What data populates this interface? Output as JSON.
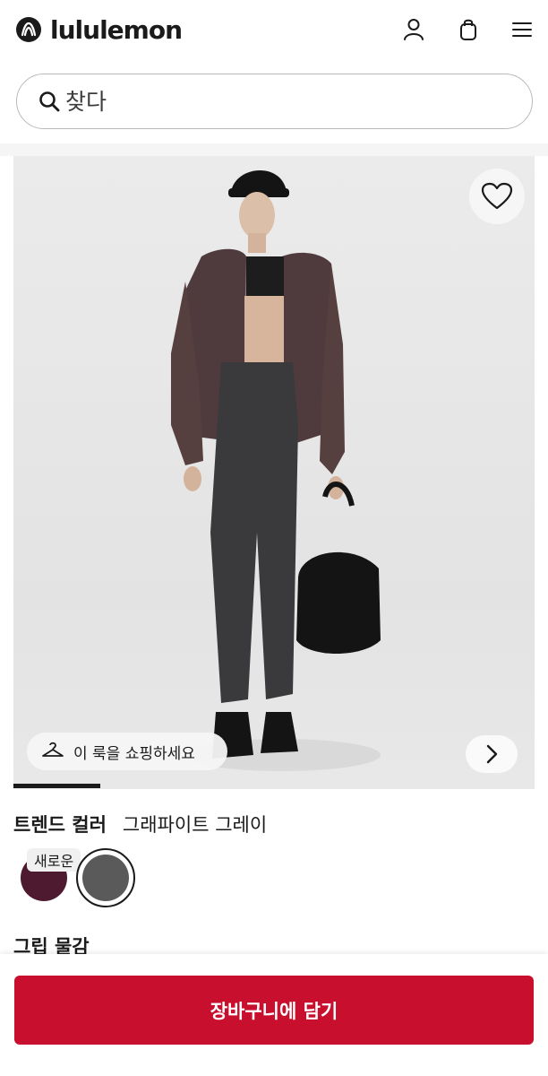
{
  "header": {
    "brand": "lululemon",
    "icons": [
      "user-icon",
      "shopping-bag-icon",
      "menu-icon"
    ]
  },
  "search": {
    "placeholder": "찾다"
  },
  "product_image": {
    "wishlist_icon": "heart-icon",
    "shop_look_label": "이 룩을 쇼핑하세요",
    "shop_look_icon": "hanger-icon",
    "next_icon": "chevron-right-icon",
    "carousel_progress": 0.17
  },
  "color": {
    "label": "트렌드 컬러",
    "selected": "그래파이트 그레이",
    "new_badge": "새로운",
    "swatches": [
      {
        "color": "#4e1a30",
        "selected": false
      },
      {
        "color": "#5a5a5a",
        "selected": true
      }
    ]
  },
  "next_section_label": "그립 물감",
  "cta": {
    "add_to_cart": "장바구니에 담기",
    "color": "#c8102e"
  }
}
